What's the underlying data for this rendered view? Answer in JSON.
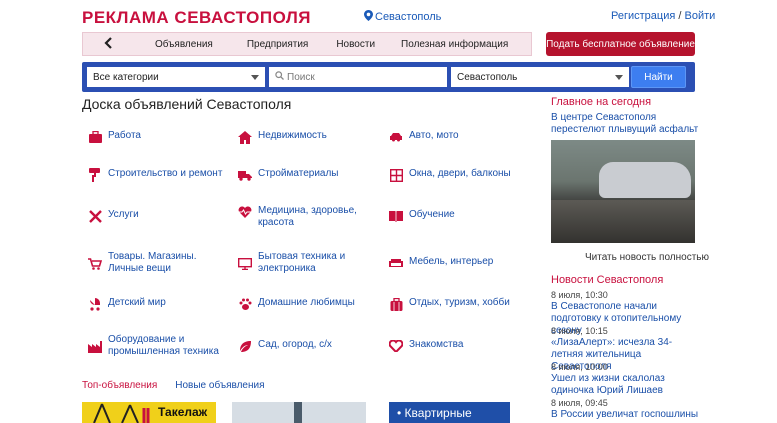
{
  "header": {
    "logo": "РЕКЛАМА СЕВАСТОПОЛЯ",
    "city": "Севастополь",
    "register": "Регистрация",
    "separator": "/",
    "login": "Войти"
  },
  "nav": {
    "items": [
      "Объявления",
      "Предприятия",
      "Новости",
      "Полезная информация"
    ],
    "post_button": "Подать бесплатное объявление"
  },
  "search": {
    "category": "Все категории",
    "placeholder": "Поиск",
    "city": "Севастополь",
    "button": "Найти"
  },
  "main": {
    "title": "Доска объявлений Севастополя",
    "categories": [
      {
        "label": "Работа",
        "icon": "briefcase-icon"
      },
      {
        "label": "Недвижимость",
        "icon": "house-icon"
      },
      {
        "label": "Авто, мото",
        "icon": "car-icon"
      },
      {
        "label": "Строительство и ремонт",
        "icon": "paint-roller-icon"
      },
      {
        "label": "Стройматериалы",
        "icon": "truck-icon"
      },
      {
        "label": "Окна, двери, балконы",
        "icon": "window-icon"
      },
      {
        "label": "Услуги",
        "icon": "tools-icon"
      },
      {
        "label": "Медицина, здоровье, красота",
        "icon": "heartbeat-icon"
      },
      {
        "label": "Обучение",
        "icon": "book-icon"
      },
      {
        "label": "Товары. Магазины. Личные вещи",
        "icon": "cart-icon"
      },
      {
        "label": "Бытовая техника и электроника",
        "icon": "monitor-icon"
      },
      {
        "label": "Мебель, интерьер",
        "icon": "sofa-icon"
      },
      {
        "label": "Детский мир",
        "icon": "stroller-icon"
      },
      {
        "label": "Домашние любимцы",
        "icon": "paw-icon"
      },
      {
        "label": "Отдых, туризм, хобби",
        "icon": "suitcase-icon"
      },
      {
        "label": "Оборудование и промышленная техника",
        "icon": "industry-icon"
      },
      {
        "label": "Сад, огород, с/х",
        "icon": "leaf-icon"
      },
      {
        "label": "Знакомства",
        "icon": "heart-icon"
      }
    ],
    "tabs": [
      "Топ-объявления",
      "Новые объявления"
    ],
    "promos": [
      "Такелаж",
      "Квартирные"
    ]
  },
  "sidebar": {
    "today_title": "Главное на сегодня",
    "today_link": "В центре Севастополя перестелют плывущий асфальт",
    "read_more": "Читать новость полностью",
    "news_title": "Новости Севастополя",
    "news": [
      {
        "date": "8 июля, 10:30",
        "title": "В Севастополе начали подготовку к отопительному сезону"
      },
      {
        "date": "8 июля, 10:15",
        "title": "«ЛизаАлерт»: исчезла 34-летняя жительница Севастополя"
      },
      {
        "date": "8 июля, 10:00",
        "title": "Ушел из жизни скалолаз одиночка Юрий Лишаев"
      },
      {
        "date": "8 июля, 09:45",
        "title": "В России увеличат госпошлины для"
      }
    ]
  },
  "colors": {
    "brand": "#c8103e",
    "search_bar": "#2b4fb3",
    "link": "#1a4fa8"
  }
}
